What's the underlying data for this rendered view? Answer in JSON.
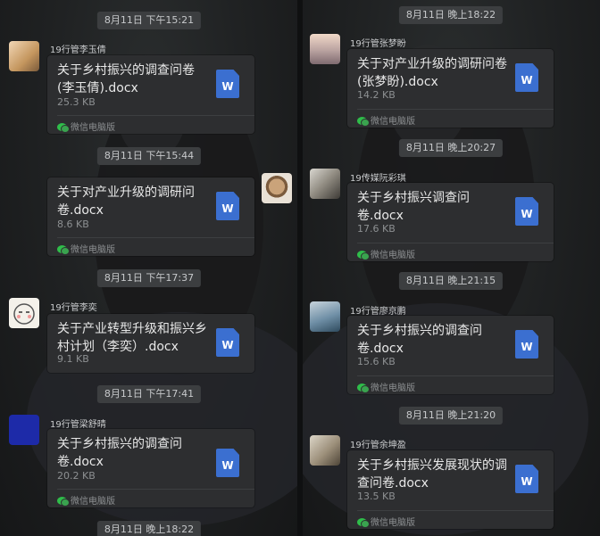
{
  "left": {
    "timestamps": [
      "8月11日 下午15:21",
      "8月11日 下午15:44",
      "8月11日 下午17:37",
      "8月11日 下午17:41",
      "8月11日 晚上18:22"
    ],
    "messages": [
      {
        "sender": "19行管李玉倩",
        "title": "关于乡村振兴的调查问卷(李玉倩).docx",
        "size": "25.3 KB",
        "source": "微信电脑版",
        "file_icon": "word-icon"
      },
      {
        "sender": "",
        "title": "关于对产业升级的调研问卷.docx",
        "size": "8.6 KB",
        "source": "微信电脑版",
        "file_icon": "word-icon"
      },
      {
        "sender": "19行管李奕",
        "title": "关于产业转型升级和振兴乡村计划（李奕）.docx",
        "size": "9.1 KB",
        "source": "",
        "file_icon": "word-icon"
      },
      {
        "sender": "19行管梁舒晴",
        "title": "关于乡村振兴的调查问卷.docx",
        "size": "20.2 KB",
        "source": "微信电脑版",
        "file_icon": "word-icon"
      }
    ]
  },
  "right": {
    "timestamps": [
      "8月11日 晚上18:22",
      "8月11日 晚上20:27",
      "8月11日 晚上21:15",
      "8月11日 晚上21:20"
    ],
    "messages": [
      {
        "sender": "19行管张梦盼",
        "title": "关于对产业升级的调研问卷(张梦盼).docx",
        "size": "14.2 KB",
        "source": "微信电脑版",
        "file_icon": "word-icon"
      },
      {
        "sender": "19传媒阮彩琪",
        "title": "关于乡村振兴调查问卷.docx",
        "size": "17.6 KB",
        "source": "微信电脑版",
        "file_icon": "word-icon"
      },
      {
        "sender": "19行管廖京鹏",
        "title": "关于乡村振兴的调查问卷.docx",
        "size": "15.6 KB",
        "source": "微信电脑版",
        "file_icon": "word-icon"
      },
      {
        "sender": "19行管余坤盈",
        "title": "关于乡村振兴发展现状的调查问卷.docx",
        "size": "13.5 KB",
        "source": "微信电脑版",
        "file_icon": "word-icon"
      }
    ]
  },
  "word_glyph": "W",
  "colors": {
    "bubble": "#2d2e30",
    "word_blue": "#3b6fd0",
    "wechat_green": "#2fbd4a",
    "timestamp_chip": "#3c3e40"
  }
}
